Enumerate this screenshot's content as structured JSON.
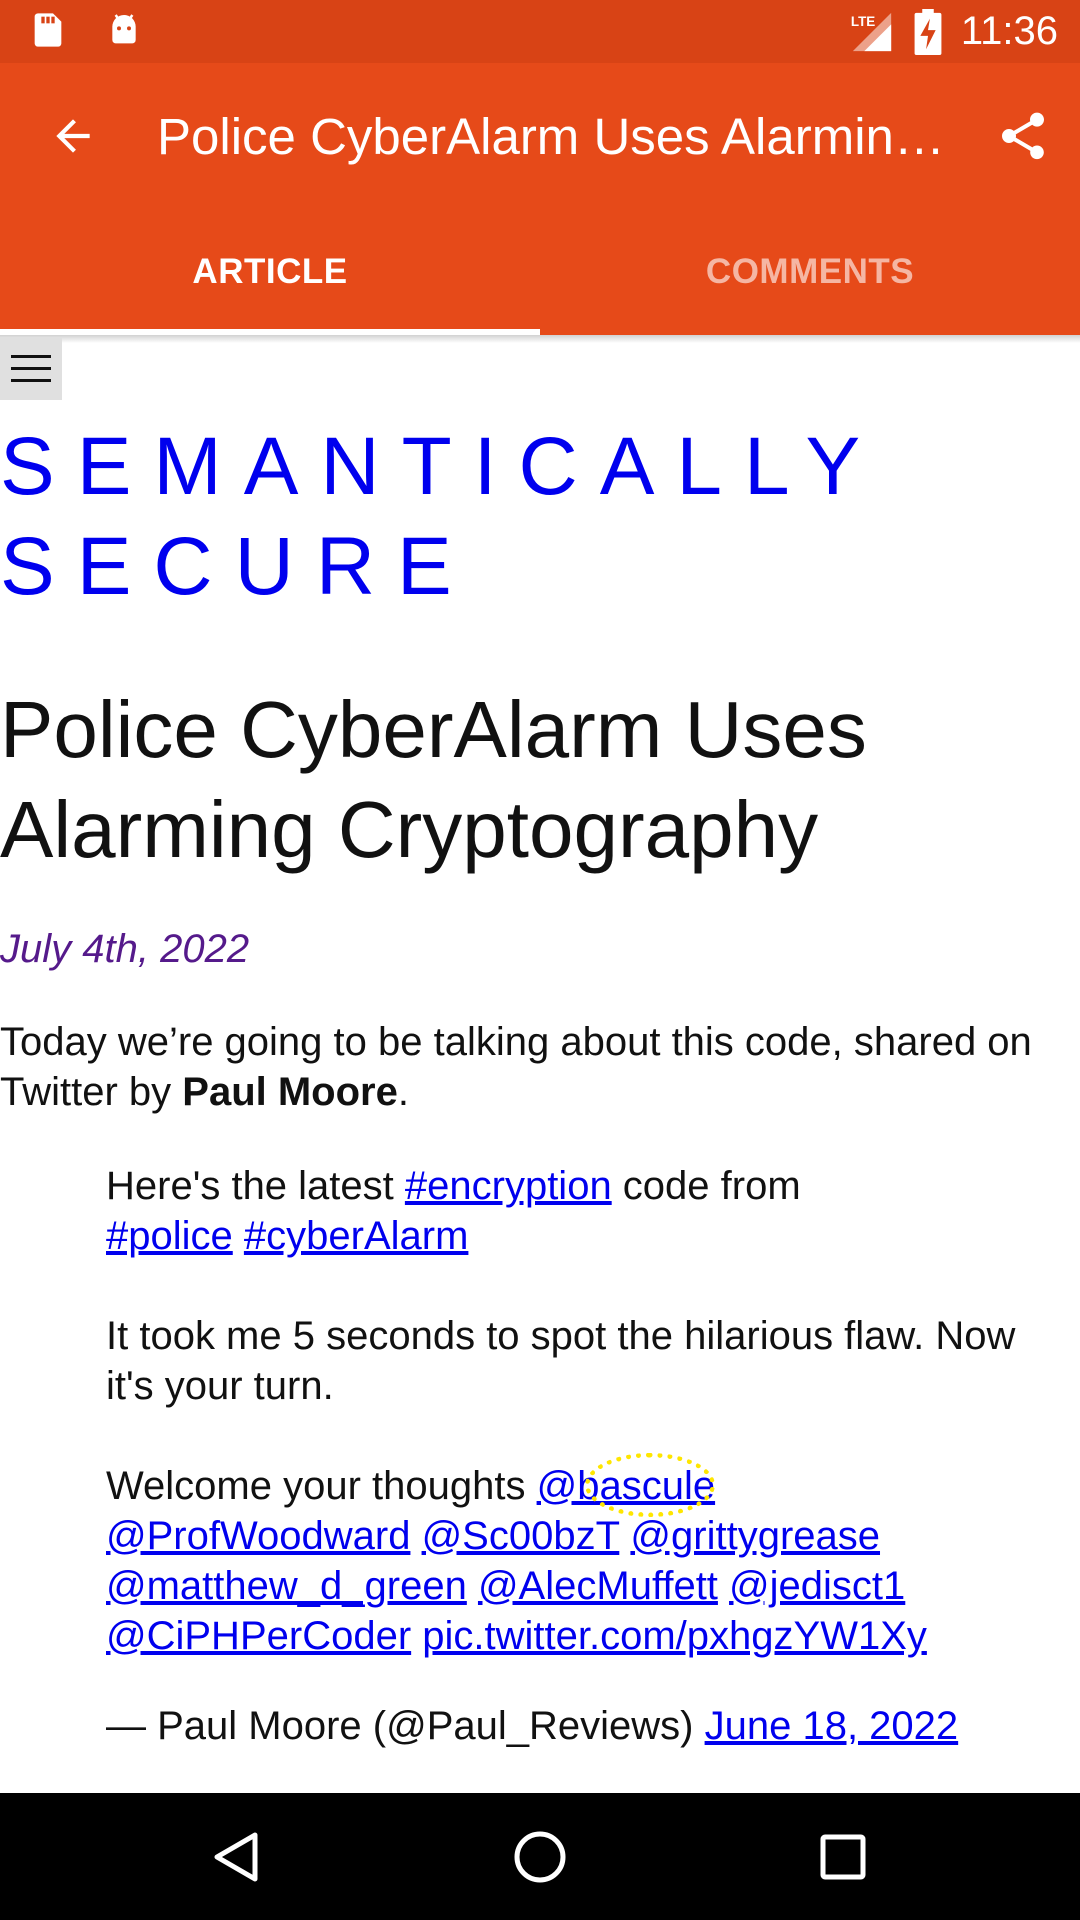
{
  "status_bar": {
    "time": "11:36",
    "network": "LTE",
    "icons": [
      "sd-card-icon",
      "android-icon",
      "lte-signal-icon",
      "battery-charging-icon"
    ]
  },
  "app_bar": {
    "title": "Police CyberAlarm Uses Alarming Cryptography",
    "back_icon": "arrow-back-icon",
    "share_icon": "share-icon"
  },
  "tabs": [
    {
      "label": "ARTICLE",
      "active": true
    },
    {
      "label": "COMMENTS",
      "active": false
    }
  ],
  "article": {
    "site_title": "SEMANTICALLY SECURE",
    "title": "Police CyberAlarm Uses Alarming Cryptography",
    "date": "July 4th, 2022",
    "intro_prefix": "Today we’re going to be talking about this code, shared on Twitter by ",
    "intro_author": "Paul Moore",
    "intro_suffix": ".",
    "quote": {
      "p1_text": "Here's the latest ",
      "p1_link1": "#encryption",
      "p1_mid": " code from ",
      "p1_link2": "#police",
      "p1_link3": "#cyberAlarm",
      "p2_text": "It took me 5 seconds to spot the hilarious flaw. Now it's your turn.",
      "p3_text": "Welcome your thoughts ",
      "mentions": [
        "@bascule",
        "@ProfWoodward",
        "@Sc00bzT",
        "@grittygrease",
        "@matthew_d_green",
        "@AlecMuffett",
        "@jedisct1",
        "@CiPHPerCoder"
      ],
      "pic_link": "pic.twitter.com/pxhgzYW1Xy",
      "sig_text": "— Paul Moore (@Paul_Reviews) ",
      "sig_date": "June 18, 2022"
    }
  },
  "colors": {
    "status_bar": "#D84315",
    "app_bar": "#E64A19",
    "link": "#0000EE",
    "visited": "#551A8B"
  }
}
